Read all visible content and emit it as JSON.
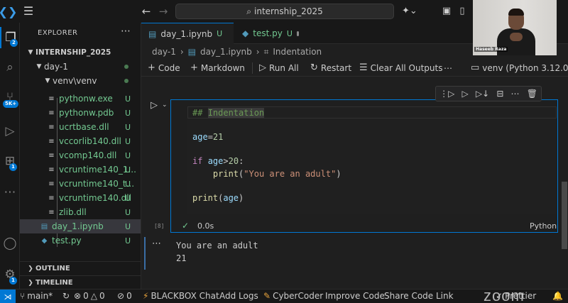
{
  "titlebar": {
    "search_text": "internship_2025"
  },
  "activity": {
    "explorer_badge": "2",
    "source_control_badge": "5K+",
    "extensions_badge": "1",
    "accounts_badge": "1"
  },
  "sidebar": {
    "header": "EXPLORER",
    "root": "INTERNSHIP_2025",
    "folder": "day-1",
    "subfolder": "venv\\venv",
    "files": [
      {
        "name": "pythonw.exe",
        "status": "U"
      },
      {
        "name": "pythonw.pdb",
        "status": "U"
      },
      {
        "name": "ucrtbase.dll",
        "status": "U"
      },
      {
        "name": "vccorlib140.dll",
        "status": "U"
      },
      {
        "name": "vcomp140.dll",
        "status": "U"
      },
      {
        "name": "vcruntime140_1...",
        "status": "U"
      },
      {
        "name": "vcruntime140_t...",
        "status": "U"
      },
      {
        "name": "vcruntime140.dll",
        "status": "U"
      },
      {
        "name": "zlib.dll",
        "status": "U"
      }
    ],
    "notebook_file": {
      "name": "day_1.ipynb",
      "status": "U"
    },
    "test_file": {
      "name": "test.py",
      "status": "U"
    },
    "outline": "OUTLINE",
    "timeline": "TIMELINE"
  },
  "tabs": [
    {
      "label": "day_1.ipynb",
      "status": "U"
    },
    {
      "label": "test.py",
      "status": "U"
    }
  ],
  "breadcrumb": {
    "folder": "day-1",
    "file": "day_1.ipynb",
    "section": "Indentation"
  },
  "toolbar": {
    "code": "Code",
    "markdown": "Markdown",
    "run_all": "Run All",
    "restart": "Restart",
    "clear_all_outputs": "Clear All Outputs",
    "kernel": "venv (Python 3.12.0)"
  },
  "cell": {
    "code": {
      "line1_hash": "##",
      "line1_heading": "Indentation",
      "line2_var": "age",
      "line2_op": "=",
      "line2_num": "21",
      "line3_kw": "if",
      "line3_var": "age",
      "line3_op": ">",
      "line3_num": "20",
      "line3_colon": ":",
      "line4_fn": "print",
      "line4_str": "\"You are an adult\"",
      "line5_fn": "print",
      "line5_var": "age"
    },
    "exec_count": "[8]",
    "exec_time": "0.0s",
    "language": "Python",
    "output_lines": [
      "You are an adult",
      "21"
    ]
  },
  "webcam": {
    "name": "Haseeb Raza"
  },
  "statusbar": {
    "branch": "main*",
    "errors": "0",
    "warnings": "0",
    "ports": "0",
    "blackbox": "BLACKBOX Chat",
    "add_logs": "Add Logs",
    "cybercoder": "CyberCoder",
    "improve_code": "Improve Code",
    "share_code_link": "Share Code Link",
    "prettier": "Prettier"
  }
}
